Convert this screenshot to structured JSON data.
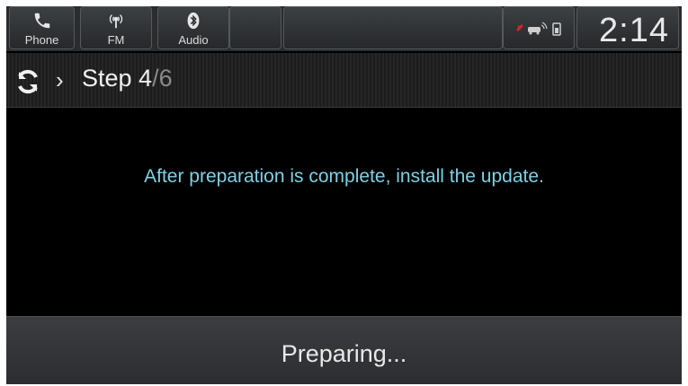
{
  "top_bar": {
    "buttons": [
      {
        "label": "Phone",
        "icon": "phone-icon"
      },
      {
        "label": "FM",
        "icon": "radio-icon"
      },
      {
        "label": "Audio",
        "icon": "bluetooth-icon"
      }
    ],
    "status_icons": [
      "signal-icon",
      "car-wifi-icon",
      "phone-battery-icon"
    ],
    "clock": "2:14"
  },
  "step": {
    "icon": "sync-icon",
    "current": "Step 4",
    "total": "/6"
  },
  "message": "After preparation is complete, install the update.",
  "footer": {
    "status": "Preparing..."
  },
  "colors": {
    "message_text": "#7fd0e4",
    "background": "#000000",
    "bar": "#2a2c2e"
  }
}
